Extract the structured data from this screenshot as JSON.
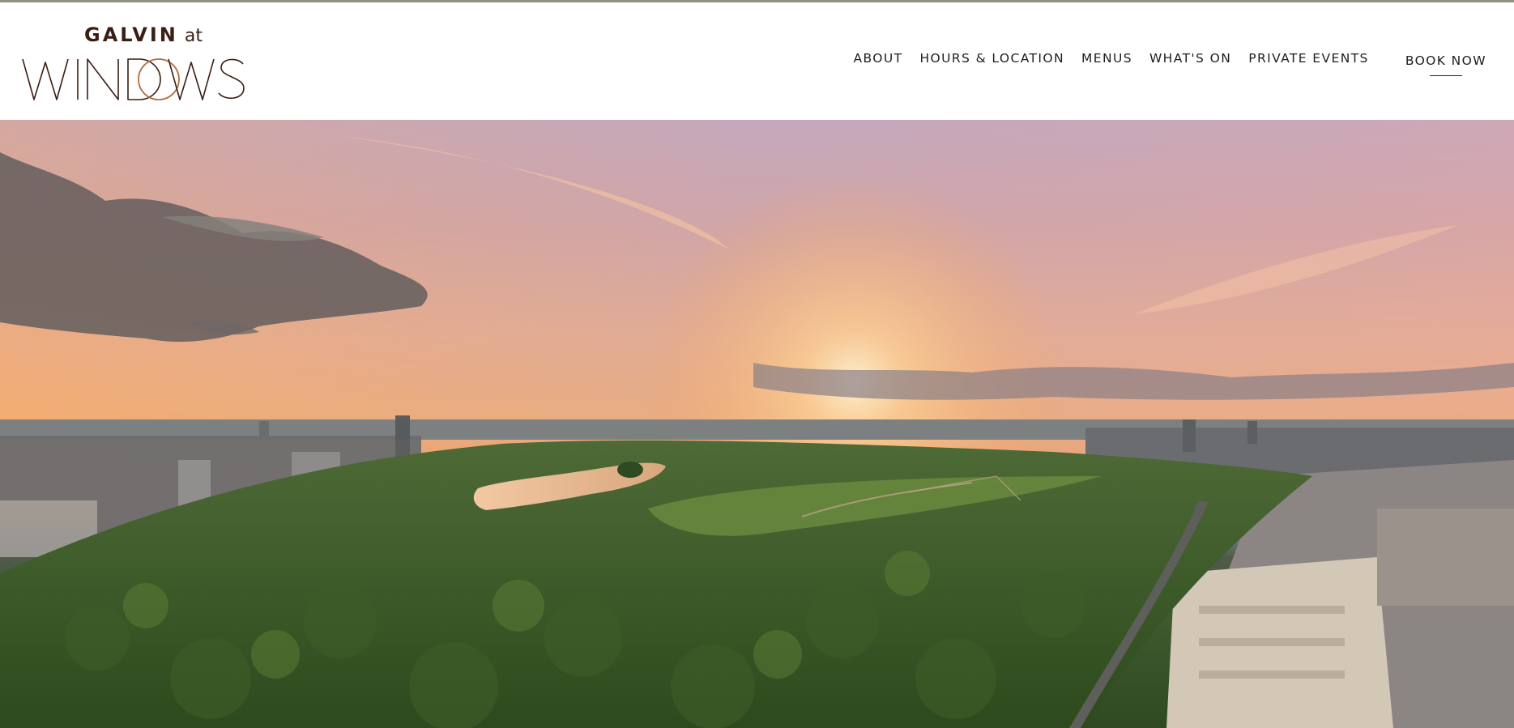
{
  "brand": {
    "top_text": "GALVIN",
    "at_text": "at",
    "wordmark": "WINDOWS",
    "colors": {
      "dark": "#3b1d14",
      "accent": "#b36b44"
    }
  },
  "nav": {
    "items": [
      {
        "label": "ABOUT"
      },
      {
        "label": "HOURS & LOCATION"
      },
      {
        "label": "MENUS"
      },
      {
        "label": "WHAT'S ON"
      },
      {
        "label": "PRIVATE EVENTS"
      }
    ],
    "book_label": "BOOK NOW"
  },
  "hero": {
    "description_icon": "sunset-panorama-image"
  },
  "colors": {
    "top_rule": "#8f927c",
    "nav_text": "#1e1e1e"
  }
}
